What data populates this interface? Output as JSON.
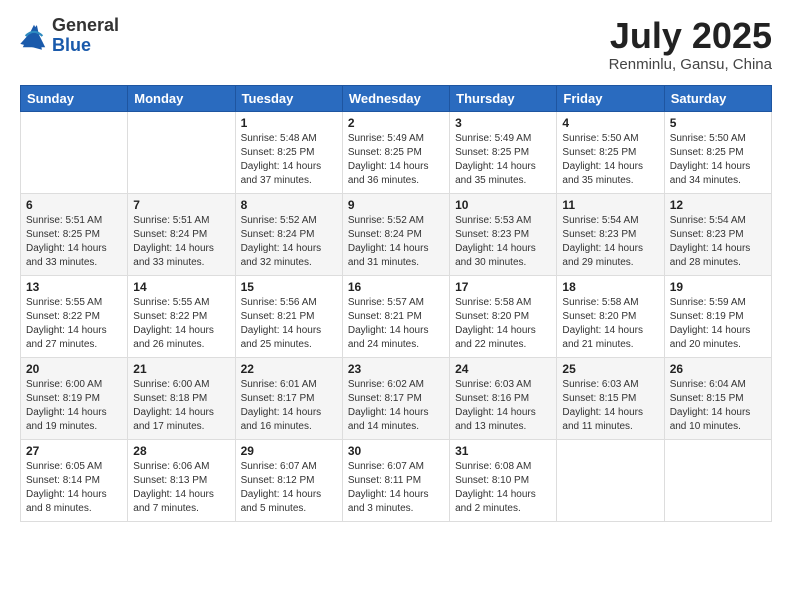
{
  "logo": {
    "general": "General",
    "blue": "Blue"
  },
  "header": {
    "month": "July 2025",
    "location": "Renminlu, Gansu, China"
  },
  "days_of_week": [
    "Sunday",
    "Monday",
    "Tuesday",
    "Wednesday",
    "Thursday",
    "Friday",
    "Saturday"
  ],
  "weeks": [
    [
      {
        "num": "",
        "info": ""
      },
      {
        "num": "",
        "info": ""
      },
      {
        "num": "1",
        "info": "Sunrise: 5:48 AM\nSunset: 8:25 PM\nDaylight: 14 hours\nand 37 minutes."
      },
      {
        "num": "2",
        "info": "Sunrise: 5:49 AM\nSunset: 8:25 PM\nDaylight: 14 hours\nand 36 minutes."
      },
      {
        "num": "3",
        "info": "Sunrise: 5:49 AM\nSunset: 8:25 PM\nDaylight: 14 hours\nand 35 minutes."
      },
      {
        "num": "4",
        "info": "Sunrise: 5:50 AM\nSunset: 8:25 PM\nDaylight: 14 hours\nand 35 minutes."
      },
      {
        "num": "5",
        "info": "Sunrise: 5:50 AM\nSunset: 8:25 PM\nDaylight: 14 hours\nand 34 minutes."
      }
    ],
    [
      {
        "num": "6",
        "info": "Sunrise: 5:51 AM\nSunset: 8:25 PM\nDaylight: 14 hours\nand 33 minutes."
      },
      {
        "num": "7",
        "info": "Sunrise: 5:51 AM\nSunset: 8:24 PM\nDaylight: 14 hours\nand 33 minutes."
      },
      {
        "num": "8",
        "info": "Sunrise: 5:52 AM\nSunset: 8:24 PM\nDaylight: 14 hours\nand 32 minutes."
      },
      {
        "num": "9",
        "info": "Sunrise: 5:52 AM\nSunset: 8:24 PM\nDaylight: 14 hours\nand 31 minutes."
      },
      {
        "num": "10",
        "info": "Sunrise: 5:53 AM\nSunset: 8:23 PM\nDaylight: 14 hours\nand 30 minutes."
      },
      {
        "num": "11",
        "info": "Sunrise: 5:54 AM\nSunset: 8:23 PM\nDaylight: 14 hours\nand 29 minutes."
      },
      {
        "num": "12",
        "info": "Sunrise: 5:54 AM\nSunset: 8:23 PM\nDaylight: 14 hours\nand 28 minutes."
      }
    ],
    [
      {
        "num": "13",
        "info": "Sunrise: 5:55 AM\nSunset: 8:22 PM\nDaylight: 14 hours\nand 27 minutes."
      },
      {
        "num": "14",
        "info": "Sunrise: 5:55 AM\nSunset: 8:22 PM\nDaylight: 14 hours\nand 26 minutes."
      },
      {
        "num": "15",
        "info": "Sunrise: 5:56 AM\nSunset: 8:21 PM\nDaylight: 14 hours\nand 25 minutes."
      },
      {
        "num": "16",
        "info": "Sunrise: 5:57 AM\nSunset: 8:21 PM\nDaylight: 14 hours\nand 24 minutes."
      },
      {
        "num": "17",
        "info": "Sunrise: 5:58 AM\nSunset: 8:20 PM\nDaylight: 14 hours\nand 22 minutes."
      },
      {
        "num": "18",
        "info": "Sunrise: 5:58 AM\nSunset: 8:20 PM\nDaylight: 14 hours\nand 21 minutes."
      },
      {
        "num": "19",
        "info": "Sunrise: 5:59 AM\nSunset: 8:19 PM\nDaylight: 14 hours\nand 20 minutes."
      }
    ],
    [
      {
        "num": "20",
        "info": "Sunrise: 6:00 AM\nSunset: 8:19 PM\nDaylight: 14 hours\nand 19 minutes."
      },
      {
        "num": "21",
        "info": "Sunrise: 6:00 AM\nSunset: 8:18 PM\nDaylight: 14 hours\nand 17 minutes."
      },
      {
        "num": "22",
        "info": "Sunrise: 6:01 AM\nSunset: 8:17 PM\nDaylight: 14 hours\nand 16 minutes."
      },
      {
        "num": "23",
        "info": "Sunrise: 6:02 AM\nSunset: 8:17 PM\nDaylight: 14 hours\nand 14 minutes."
      },
      {
        "num": "24",
        "info": "Sunrise: 6:03 AM\nSunset: 8:16 PM\nDaylight: 14 hours\nand 13 minutes."
      },
      {
        "num": "25",
        "info": "Sunrise: 6:03 AM\nSunset: 8:15 PM\nDaylight: 14 hours\nand 11 minutes."
      },
      {
        "num": "26",
        "info": "Sunrise: 6:04 AM\nSunset: 8:15 PM\nDaylight: 14 hours\nand 10 minutes."
      }
    ],
    [
      {
        "num": "27",
        "info": "Sunrise: 6:05 AM\nSunset: 8:14 PM\nDaylight: 14 hours\nand 8 minutes."
      },
      {
        "num": "28",
        "info": "Sunrise: 6:06 AM\nSunset: 8:13 PM\nDaylight: 14 hours\nand 7 minutes."
      },
      {
        "num": "29",
        "info": "Sunrise: 6:07 AM\nSunset: 8:12 PM\nDaylight: 14 hours\nand 5 minutes."
      },
      {
        "num": "30",
        "info": "Sunrise: 6:07 AM\nSunset: 8:11 PM\nDaylight: 14 hours\nand 3 minutes."
      },
      {
        "num": "31",
        "info": "Sunrise: 6:08 AM\nSunset: 8:10 PM\nDaylight: 14 hours\nand 2 minutes."
      },
      {
        "num": "",
        "info": ""
      },
      {
        "num": "",
        "info": ""
      }
    ]
  ]
}
